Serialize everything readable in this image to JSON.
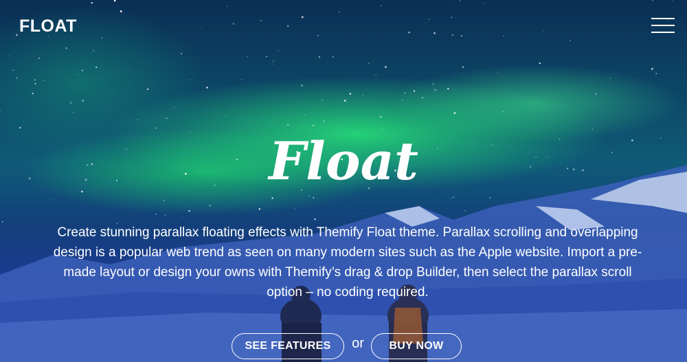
{
  "header": {
    "logo_text": "FLOAT",
    "menu_icon": "hamburger-menu-icon"
  },
  "hero": {
    "title": "Float",
    "description": "Create stunning parallax floating effects with Themify Float theme. Parallax scrolling and overlapping design is a popular web trend as seen on many modern sites such as the Apple website. Import a pre-made layout or design your owns with Themify’s drag & drop Builder, then select the parallax scroll option – no coding required.",
    "buttons": {
      "features_label": "SEE FEATURES",
      "separator": "or",
      "buy_label": "BUY NOW"
    }
  },
  "colors": {
    "text": "#ffffff",
    "aurora": "#28e678",
    "sky_top": "#0a2f55",
    "sky_bottom": "#243f93"
  }
}
